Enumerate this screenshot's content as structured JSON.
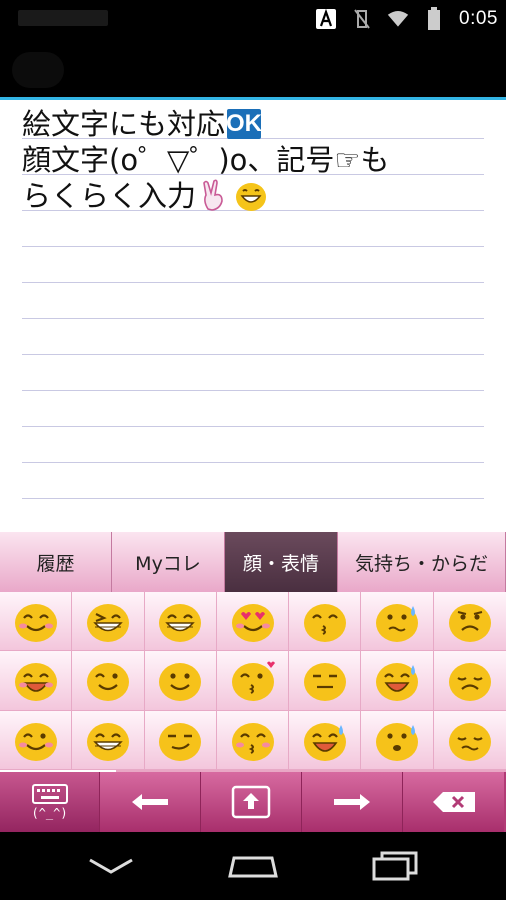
{
  "status_bar": {
    "time": "0:05",
    "icons": [
      "app-a-icon",
      "vibrate-off-icon",
      "wifi-icon",
      "battery-icon"
    ]
  },
  "editor": {
    "lines": [
      "絵文字にも対応",
      "顔文字(o゜▽゜)o、記号☞も",
      "らくらく入力"
    ],
    "ok_badge": "OK",
    "inline_icons": [
      "ok-badge-icon",
      "victory-hand-icon",
      "grinning-face-icon"
    ],
    "accent_color": "#33b5e5"
  },
  "keyboard": {
    "tabs": [
      {
        "label": "履歴",
        "active": false
      },
      {
        "label": "Myコレ",
        "active": false
      },
      {
        "label": "顔・表情",
        "active": true
      },
      {
        "label": "気持ち・からだ",
        "active": false
      }
    ],
    "emoji_rows": [
      [
        "smiling-closed-eyes",
        "squinting-wink",
        "grinning-teeth",
        "heart-eyes",
        "kissing-face",
        "nervous-face",
        "frowning-face"
      ],
      [
        "laughing-face",
        "winking-face",
        "smiling-face",
        "blowing-kiss",
        "unamused-face",
        "crying-face",
        "pensive-face"
      ],
      [
        "winking-grin",
        "beaming-face",
        "smirking-face",
        "kissing-blush",
        "sweat-smile",
        "anxious-sweat",
        "worried-face"
      ]
    ],
    "function_keys": {
      "mode_label": "(^_^)",
      "keys": [
        "keyboard-toggle-icon",
        "left-arrow-icon",
        "enter-icon",
        "right-arrow-icon",
        "backspace-icon"
      ]
    },
    "colors": {
      "tab_active": "#5a3a4c",
      "function_key": "#c0447f"
    }
  },
  "nav_bar": {
    "buttons": [
      "back-icon",
      "home-icon",
      "recent-apps-icon"
    ]
  }
}
